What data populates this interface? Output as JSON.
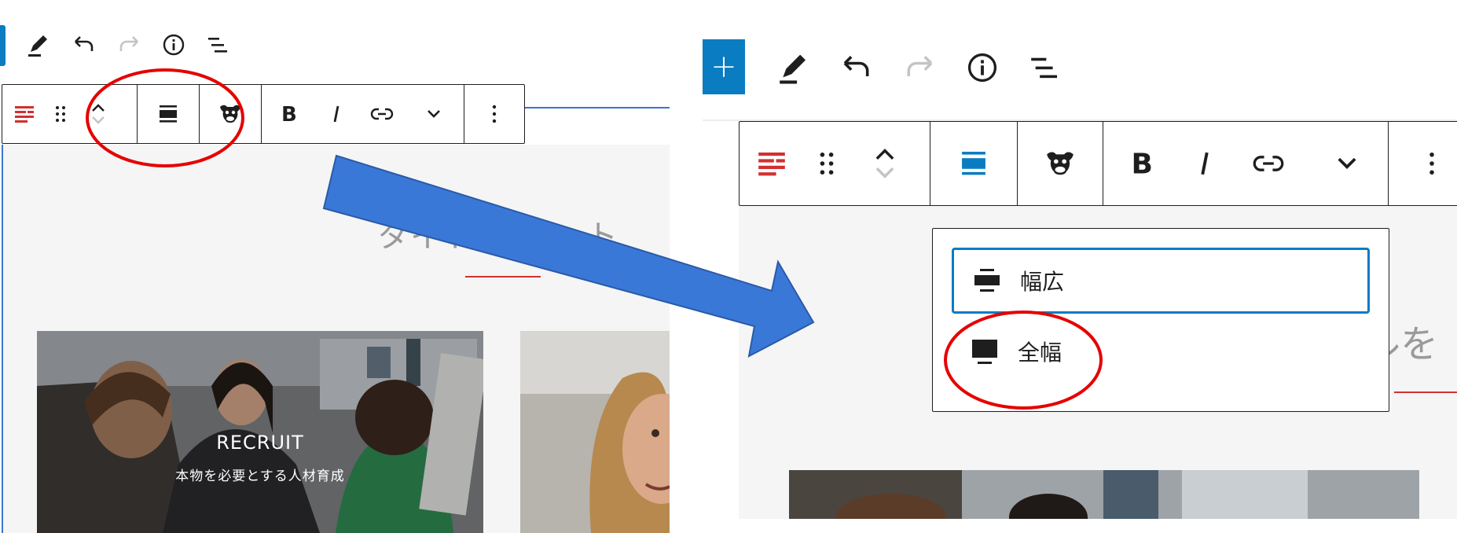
{
  "colors": {
    "accent": "#0a7cc1",
    "annotation_red": "#e60000",
    "arrow_blue": "#3a78d8",
    "brand_red": "#d13030"
  },
  "left": {
    "title_partial": "タイト",
    "title_partial_tail": "ト",
    "card": {
      "title": "RECRUIT",
      "subtitle": "本物を必要とする人材育成"
    }
  },
  "right": {
    "add_label": "+",
    "title_partial": "トルを",
    "align_menu": {
      "items": [
        {
          "label": "幅広",
          "icon": "align-wide-icon",
          "selected": true
        },
        {
          "label": "全幅",
          "icon": "align-full-width-icon",
          "selected": false
        }
      ]
    }
  },
  "top_toolbar_icons": [
    "pencil-icon",
    "undo-icon",
    "redo-icon",
    "info-icon",
    "list-view-icon"
  ],
  "block_toolbar_icons": [
    "block-type-icon",
    "drag-handle-icon",
    "move-up-icon",
    "move-down-icon",
    "align-icon",
    "monkey-icon",
    "bold-icon",
    "italic-icon",
    "link-icon",
    "chevron-down-icon",
    "more-options-icon"
  ]
}
